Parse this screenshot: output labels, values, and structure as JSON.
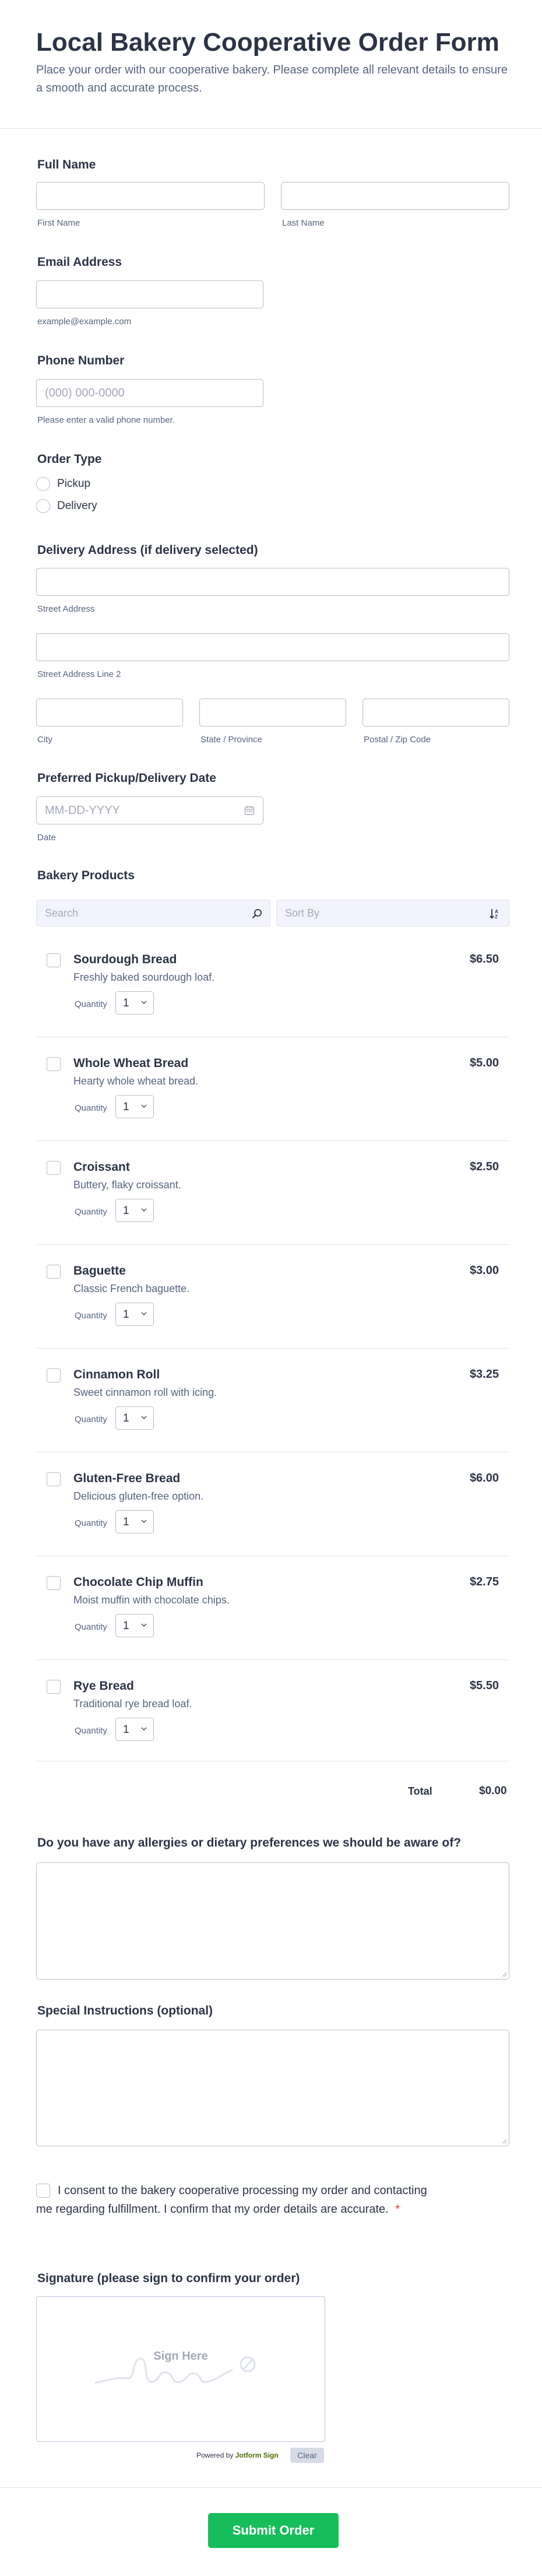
{
  "header": {
    "title": "Local Bakery Cooperative Order Form",
    "description": "Place your order with our cooperative bakery. Please complete all relevant details to ensure a smooth and accurate process."
  },
  "full_name": {
    "label": "Full Name",
    "first_sub": "First Name",
    "last_sub": "Last Name"
  },
  "email": {
    "label": "Email Address",
    "sub": "example@example.com"
  },
  "phone": {
    "label": "Phone Number",
    "placeholder": "(000) 000-0000",
    "sub": "Please enter a valid phone number."
  },
  "order_type": {
    "label": "Order Type",
    "options": [
      "Pickup",
      "Delivery"
    ]
  },
  "address": {
    "label": "Delivery Address (if delivery selected)",
    "street": "Street Address",
    "street2": "Street Address Line 2",
    "city": "City",
    "state": "State / Province",
    "zip": "Postal / Zip Code"
  },
  "date": {
    "label": "Preferred Pickup/Delivery Date",
    "placeholder": "MM-DD-YYYY",
    "sub": "Date"
  },
  "products": {
    "label": "Bakery Products",
    "search_placeholder": "Search",
    "sort_placeholder": "Sort By",
    "quantity_label": "Quantity",
    "items": [
      {
        "name": "Sourdough Bread",
        "desc": "Freshly baked sourdough loaf.",
        "price": "$6.50",
        "qty": "1"
      },
      {
        "name": "Whole Wheat Bread",
        "desc": "Hearty whole wheat bread.",
        "price": "$5.00",
        "qty": "1"
      },
      {
        "name": "Croissant",
        "desc": "Buttery, flaky croissant.",
        "price": "$2.50",
        "qty": "1"
      },
      {
        "name": "Baguette",
        "desc": "Classic French baguette.",
        "price": "$3.00",
        "qty": "1"
      },
      {
        "name": "Cinnamon Roll",
        "desc": "Sweet cinnamon roll with icing.",
        "price": "$3.25",
        "qty": "1"
      },
      {
        "name": "Gluten-Free Bread",
        "desc": "Delicious gluten-free option.",
        "price": "$6.00",
        "qty": "1"
      },
      {
        "name": "Chocolate Chip Muffin",
        "desc": "Moist muffin with chocolate chips.",
        "price": "$2.75",
        "qty": "1"
      },
      {
        "name": "Rye Bread",
        "desc": "Traditional rye bread loaf.",
        "price": "$5.50",
        "qty": "1"
      }
    ],
    "total_label": "Total",
    "total_value": "$0.00"
  },
  "allergies": {
    "label": "Do you have any allergies or dietary preferences we should be aware of?"
  },
  "instructions": {
    "label": "Special Instructions (optional)"
  },
  "consent": {
    "line1": "I consent to the bakery cooperative processing my order and contacting",
    "line2": "me regarding fulfillment. I confirm that my order details are accurate.",
    "required_mark": "*"
  },
  "signature": {
    "label": "Signature (please sign to confirm your order)",
    "placeholder": "Sign Here",
    "powered_by": "Powered by",
    "brand": "Jotform Sign",
    "clear_label": "Clear"
  },
  "submit_label": "Submit Order",
  "colors": {
    "accent": "#18bd5b",
    "required": "#f23a3c",
    "text": "#2c3345",
    "muted": "#57647e"
  },
  "icons": {
    "search": "search-icon",
    "sort": "sort-icon",
    "calendar": "calendar-icon",
    "chevron": "chevron-down-icon"
  }
}
